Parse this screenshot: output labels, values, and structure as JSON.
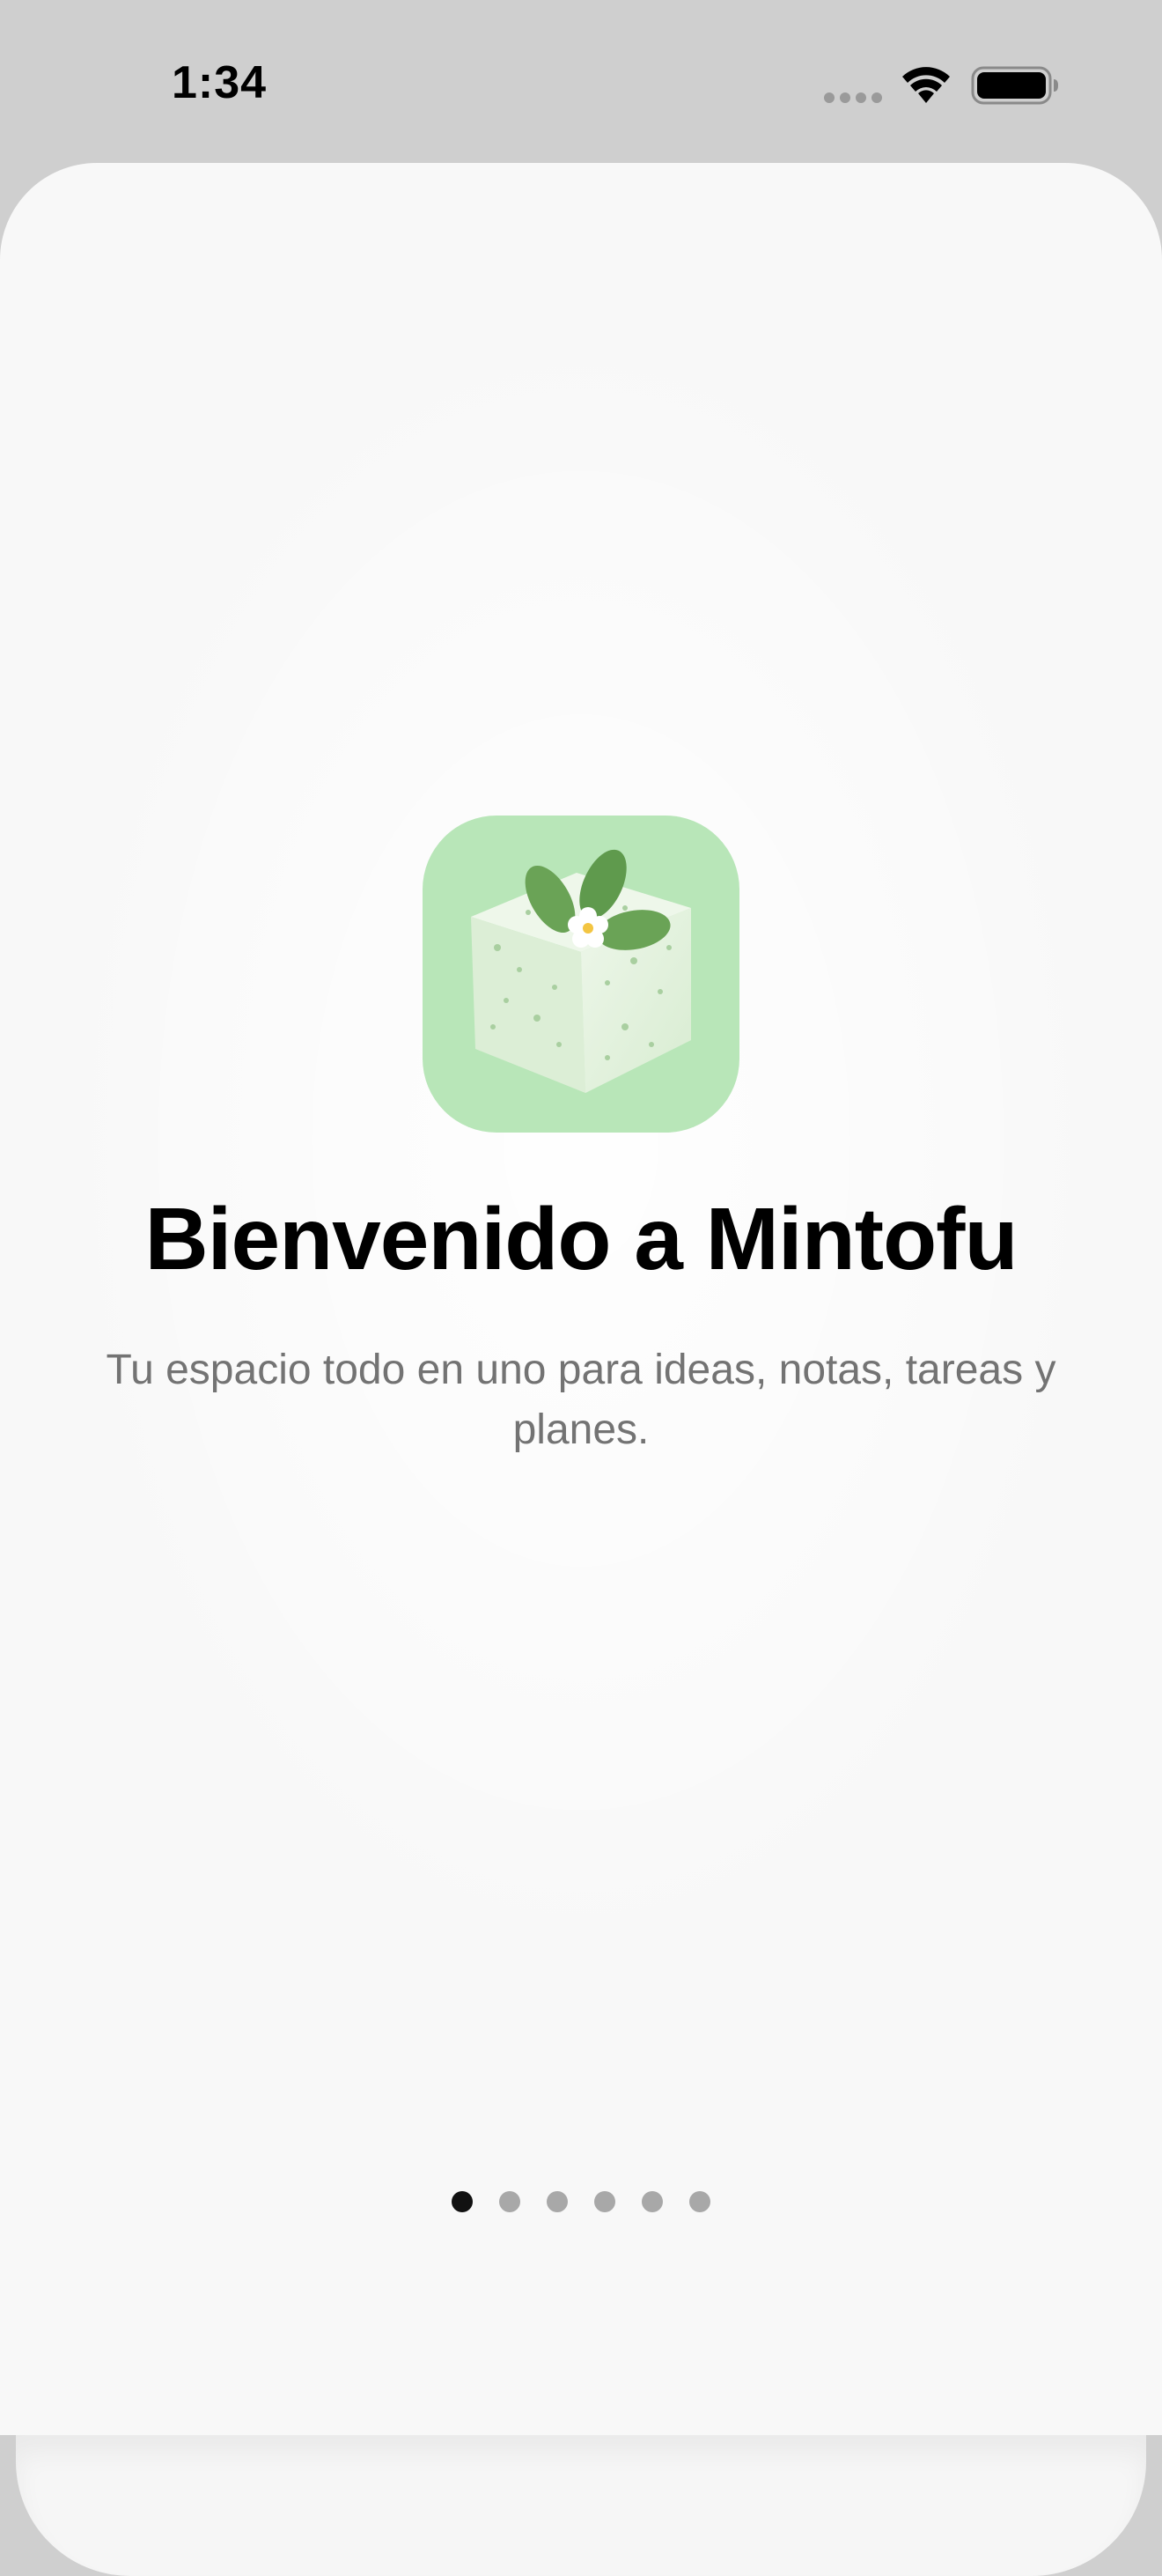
{
  "status_bar": {
    "time": "1:34",
    "icons": [
      "signal-dots-icon",
      "wifi-icon",
      "battery-icon"
    ]
  },
  "onboarding": {
    "app_icon": "mintofu-tofu-logo-icon",
    "title": "Bienvenido a Mintofu",
    "subtitle": "Tu espacio todo en uno para ideas, notas, tareas y planes.",
    "pages": {
      "count": 6,
      "current": 1
    }
  },
  "colors": {
    "background": "#f8f8f8",
    "icon_background": "#b8e6b8",
    "title": "#000000",
    "subtitle": "#737373",
    "dot_active": "#111111",
    "dot_inactive": "#a8a8a8"
  }
}
